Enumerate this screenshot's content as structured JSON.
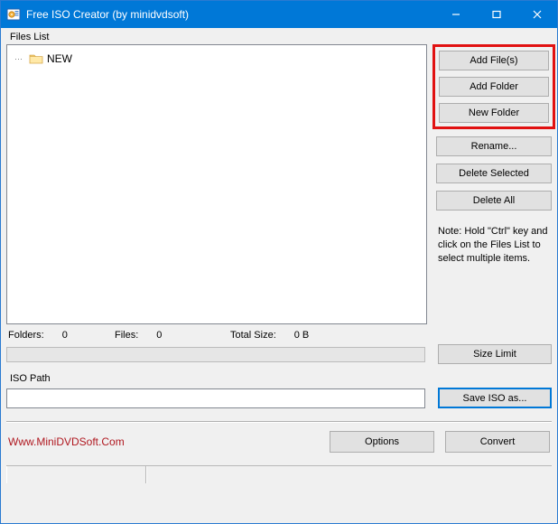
{
  "window": {
    "title": "Free ISO Creator (by minidvdsoft)"
  },
  "labels": {
    "files_list": "Files List",
    "iso_path": "ISO Path"
  },
  "tree": {
    "items": [
      {
        "name": "NEW"
      }
    ]
  },
  "buttons": {
    "add_files": "Add File(s)",
    "add_folder": "Add Folder",
    "new_folder": "New Folder",
    "rename": "Rename...",
    "delete_selected": "Delete Selected",
    "delete_all": "Delete All",
    "size_limit": "Size Limit",
    "save_iso_as": "Save ISO as...",
    "options": "Options",
    "convert": "Convert"
  },
  "note": "Note: Hold \"Ctrl\" key and click on the Files List to select multiple items.",
  "stats": {
    "folders_label": "Folders:",
    "folders_value": "0",
    "files_label": "Files:",
    "files_value": "0",
    "total_size_label": "Total Size:",
    "total_size_value": "0 B"
  },
  "iso_path_value": "",
  "footer_link": "Www.MiniDVDSoft.Com"
}
